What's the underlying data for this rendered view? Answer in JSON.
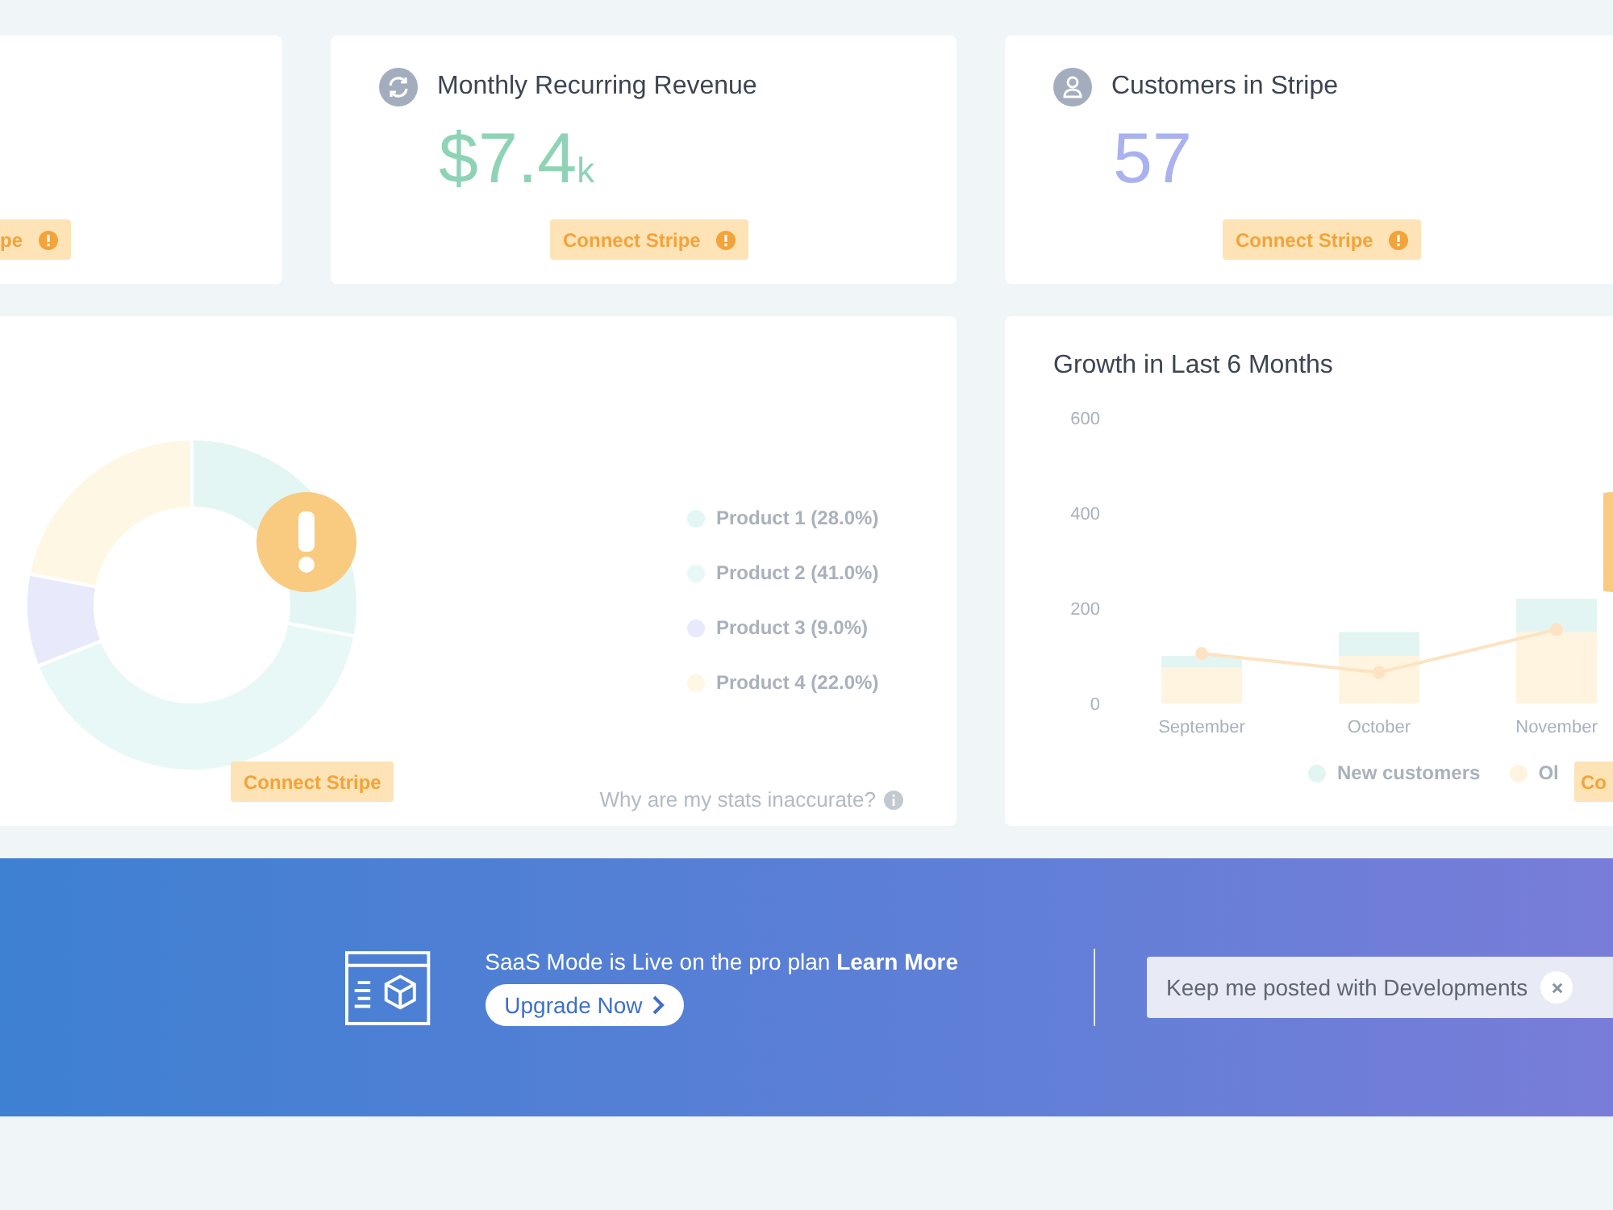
{
  "stat_cards": [
    {
      "kind": "partial",
      "badge": "pe"
    },
    {
      "kind": "revenue",
      "title": "Monthly Recurring Revenue",
      "value": "$7.4",
      "unit": "k",
      "color": "#8fd3b6",
      "badge": "Connect Stripe"
    },
    {
      "kind": "customers",
      "title": "Customers in Stripe",
      "value": "57",
      "color": "#a9b1ee",
      "badge": "Connect Stripe"
    }
  ],
  "products_card": {
    "chart_data": {
      "type": "donut",
      "categories": [
        "Product 1 (28.0%)",
        "Product 2 (41.0%)",
        "Product 3 (9.0%)",
        "Product 4 (22.0%)"
      ],
      "values": [
        28,
        41,
        9,
        22
      ]
    },
    "legend": [
      {
        "color": "#e3f6f3"
      },
      {
        "color": "#e8f8f6"
      },
      {
        "color": "#e8e9fb"
      },
      {
        "color": "#fef7e3"
      }
    ],
    "badge": "Connect Stripe",
    "help_link": "Why are my stats inaccurate?"
  },
  "growth_card": {
    "title": "Growth in Last 6 Months",
    "chart_data": {
      "type": "bar",
      "stacked": true,
      "categories": [
        "September",
        "October",
        "November"
      ],
      "ylim": [
        0,
        600
      ],
      "yticks": [
        0,
        200,
        400,
        600
      ],
      "series": [
        {
          "name": "New customers",
          "color": "#e3f5f2",
          "values": [
            25,
            50,
            70
          ]
        },
        {
          "name": "Ol",
          "color": "#fef4df",
          "values": [
            75,
            100,
            150
          ]
        },
        {
          "type": "line",
          "color": "#fde3c3",
          "marker": true,
          "values": [
            105,
            65,
            155
          ]
        }
      ]
    },
    "badge": "Co"
  },
  "banner": {
    "message": "SaaS Mode is Live on the pro plan",
    "link": "Learn More",
    "button": "Upgrade Now",
    "subscribe": "Keep me posted with Developments"
  }
}
